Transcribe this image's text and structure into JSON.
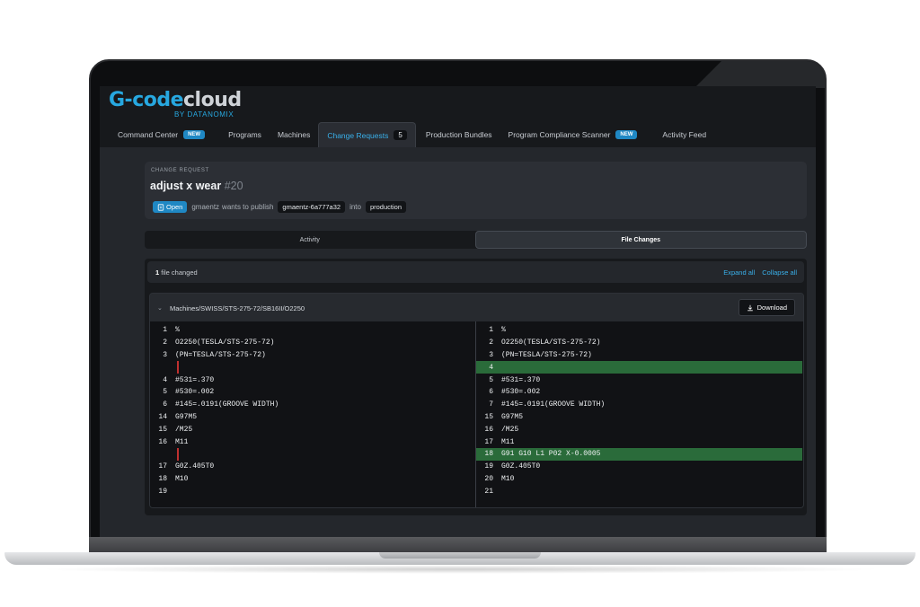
{
  "app": {
    "logo_part1": "G-code",
    "logo_part2": "cloud",
    "logo_sub": "BY DATANOMIX"
  },
  "nav": {
    "tabs": [
      {
        "label": "Command Center",
        "badge": "NEW"
      },
      {
        "label": "Programs"
      },
      {
        "label": "Machines"
      },
      {
        "label": "Change Requests",
        "count": "5"
      },
      {
        "label": "Production Bundles"
      },
      {
        "label": "Program Compliance Scanner",
        "badge": "NEW"
      },
      {
        "label": "Activity Feed"
      }
    ],
    "active_tab": "Change Requests"
  },
  "change_request": {
    "eyebrow": "CHANGE REQUEST",
    "title": "adjust x wear",
    "number": "#20",
    "status": "Open",
    "author": "gmaentz",
    "wants_text": "wants to publish",
    "source_branch": "gmaentz-6a777a32",
    "into_text": "into",
    "target_branch": "production"
  },
  "views": {
    "activity": "Activity",
    "file_changes": "File Changes",
    "active": "File Changes"
  },
  "files": {
    "count": "1",
    "count_label": "file changed",
    "expand_all": "Expand all",
    "collapse_all": "Collapse all",
    "path": "Machines/SWISS/STS-275-72/SB16II/O2250",
    "download": "Download"
  },
  "diff": {
    "left": [
      {
        "n": "1",
        "code": "%"
      },
      {
        "n": "2",
        "code": "O2250(TESLA/STS-275-72)"
      },
      {
        "n": "3",
        "code": "(PN=TESLA/STS-275-72)"
      },
      {
        "n": "",
        "code": "",
        "gap": true
      },
      {
        "n": "4",
        "code": "#531=.370"
      },
      {
        "n": "5",
        "code": "#530=.002"
      },
      {
        "n": "6",
        "code": "#145=.0191(GROOVE WIDTH)"
      },
      {
        "n": "14",
        "code": "G97M5"
      },
      {
        "n": "15",
        "code": "/M25"
      },
      {
        "n": "16",
        "code": "M11"
      },
      {
        "n": "",
        "code": "",
        "gap": true
      },
      {
        "n": "17",
        "code": "G0Z.405T0"
      },
      {
        "n": "18",
        "code": "M10"
      },
      {
        "n": "19",
        "code": ""
      }
    ],
    "right": [
      {
        "n": "1",
        "code": "%"
      },
      {
        "n": "2",
        "code": "O2250(TESLA/STS-275-72)"
      },
      {
        "n": "3",
        "code": "(PN=TESLA/STS-275-72)"
      },
      {
        "n": "4",
        "code": "",
        "added": true
      },
      {
        "n": "5",
        "code": "#531=.370"
      },
      {
        "n": "6",
        "code": "#530=.002"
      },
      {
        "n": "7",
        "code": "#145=.0191(GROOVE WIDTH)"
      },
      {
        "n": "15",
        "code": "G97M5"
      },
      {
        "n": "16",
        "code": "/M25"
      },
      {
        "n": "17",
        "code": "M11"
      },
      {
        "n": "18",
        "code": "G91 G10 L1 P02 X-0.0005",
        "added": true
      },
      {
        "n": "19",
        "code": "G0Z.405T0"
      },
      {
        "n": "20",
        "code": "M10"
      },
      {
        "n": "21",
        "code": ""
      }
    ]
  }
}
